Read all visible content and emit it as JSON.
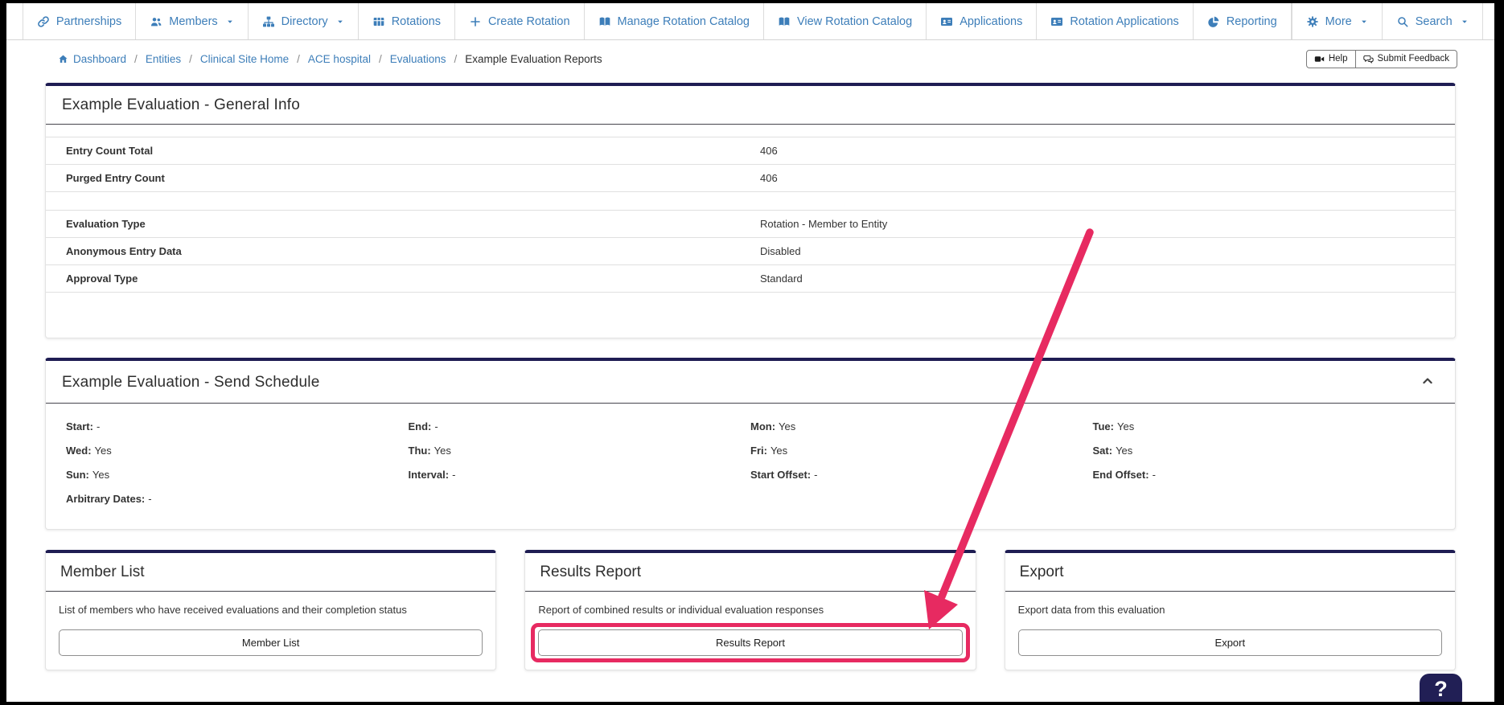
{
  "nav": {
    "items": [
      {
        "label": "Partnerships",
        "icon": "link-icon"
      },
      {
        "label": "Members",
        "icon": "users-icon",
        "caret": true
      },
      {
        "label": "Directory",
        "icon": "sitemap-icon",
        "caret": true
      },
      {
        "label": "Rotations",
        "icon": "table-icon"
      },
      {
        "label": "Create Rotation",
        "icon": "plus-icon"
      },
      {
        "label": "Manage Rotation Catalog",
        "icon": "book-icon"
      },
      {
        "label": "View Rotation Catalog",
        "icon": "book-icon"
      },
      {
        "label": "Applications",
        "icon": "id-card-icon"
      },
      {
        "label": "Rotation Applications",
        "icon": "id-card-icon"
      },
      {
        "label": "Reporting",
        "icon": "pie-chart-icon"
      }
    ],
    "right_items": [
      {
        "label": "More",
        "icon": "gear-icon",
        "caret": true
      },
      {
        "label": "Search",
        "icon": "search-icon",
        "caret": true
      }
    ]
  },
  "breadcrumb": {
    "separator": "/",
    "items": [
      {
        "label": "Dashboard"
      },
      {
        "label": "Entities"
      },
      {
        "label": "Clinical Site Home"
      },
      {
        "label": "ACE hospital"
      },
      {
        "label": "Evaluations"
      },
      {
        "label": "Example Evaluation Reports"
      }
    ]
  },
  "header_actions": {
    "help": "Help",
    "submit_feedback": "Submit Feedback"
  },
  "general_info": {
    "title": "Example Evaluation - General Info",
    "rows_a": [
      {
        "label": "Entry Count Total",
        "value": "406"
      },
      {
        "label": "Purged Entry Count",
        "value": "406"
      }
    ],
    "rows_b": [
      {
        "label": "Evaluation Type",
        "value": "Rotation - Member to Entity"
      },
      {
        "label": "Anonymous Entry Data",
        "value": "Disabled"
      },
      {
        "label": "Approval Type",
        "value": "Standard"
      }
    ]
  },
  "send_schedule": {
    "title": "Example Evaluation - Send Schedule",
    "fields": [
      {
        "label": "Start:",
        "value": "-"
      },
      {
        "label": "End:",
        "value": "-"
      },
      {
        "label": "Mon:",
        "value": "Yes"
      },
      {
        "label": "Tue:",
        "value": "Yes"
      },
      {
        "label": "Wed:",
        "value": "Yes"
      },
      {
        "label": "Thu:",
        "value": "Yes"
      },
      {
        "label": "Fri:",
        "value": "Yes"
      },
      {
        "label": "Sat:",
        "value": "Yes"
      },
      {
        "label": "Sun:",
        "value": "Yes"
      },
      {
        "label": "Interval:",
        "value": "-"
      },
      {
        "label": "Start Offset:",
        "value": "-"
      },
      {
        "label": "End Offset:",
        "value": "-"
      },
      {
        "label": "Arbitrary Dates:",
        "value": "-"
      }
    ]
  },
  "cards": [
    {
      "title": "Member List",
      "description": "List of members who have received evaluations and their completion status",
      "button": "Member List"
    },
    {
      "title": "Results Report",
      "description": "Report of combined results or individual evaluation responses",
      "button": "Results Report",
      "highlighted": true
    },
    {
      "title": "Export",
      "description": "Export data from this evaluation",
      "button": "Export"
    }
  ],
  "help_widget": {
    "label": "?"
  },
  "colors": {
    "navy": "#1f1d53",
    "annotation_pink": "#e72a61",
    "link_blue": "#3d7eb9"
  }
}
